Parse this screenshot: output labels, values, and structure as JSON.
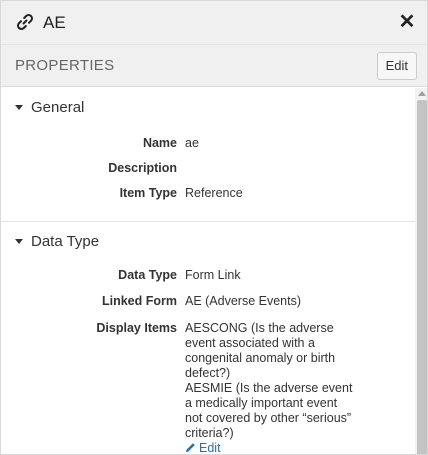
{
  "header": {
    "title": "AE",
    "link_icon": "link-icon",
    "close_label": "✕"
  },
  "toolbar": {
    "properties_label": "PROPERTIES",
    "edit_label": "Edit"
  },
  "sections": {
    "general": {
      "label": "General",
      "name_label": "Name",
      "name_value": "ae",
      "description_label": "Description",
      "description_value": "",
      "item_type_label": "Item Type",
      "item_type_value": "Reference"
    },
    "data_type": {
      "label": "Data Type",
      "data_type_label": "Data Type",
      "data_type_value": "Form Link",
      "linked_form_label": "Linked Form",
      "linked_form_value": "AE (Adverse Events)",
      "display_items_label": "Display Items",
      "display_items_lines": [
        "AESCONG (Is the adverse",
        "event associated with a",
        "congenital anomaly or birth",
        "defect?)",
        "AESMIE (Is the adverse event",
        "a medically important event",
        "not covered by other “serious”",
        "criteria?)"
      ],
      "edit_link_label": "Edit"
    }
  },
  "colors": {
    "header_bg": "#f0f0f0",
    "link_blue": "#2a6fb5",
    "scroll_thumb": "#c4c4c4"
  }
}
